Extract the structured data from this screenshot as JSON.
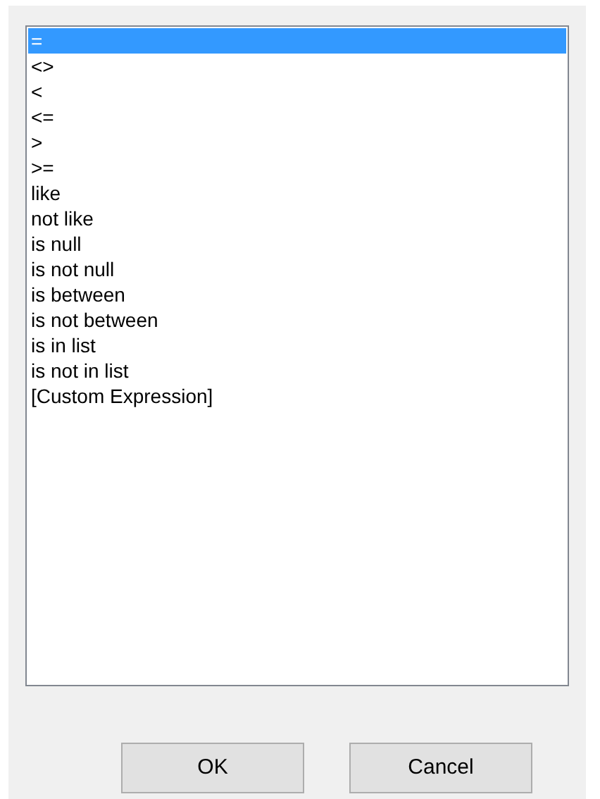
{
  "operators": [
    {
      "label": "=",
      "selected": true
    },
    {
      "label": "<>",
      "selected": false
    },
    {
      "label": "<",
      "selected": false
    },
    {
      "label": "<=",
      "selected": false
    },
    {
      "label": ">",
      "selected": false
    },
    {
      "label": ">=",
      "selected": false
    },
    {
      "label": "like",
      "selected": false
    },
    {
      "label": "not like",
      "selected": false
    },
    {
      "label": "is null",
      "selected": false
    },
    {
      "label": "is not null",
      "selected": false
    },
    {
      "label": "is between",
      "selected": false
    },
    {
      "label": "is not between",
      "selected": false
    },
    {
      "label": "is in list",
      "selected": false
    },
    {
      "label": "is not in list",
      "selected": false
    },
    {
      "label": "[Custom Expression]",
      "selected": false
    }
  ],
  "buttons": [
    "OK",
    "Cancel"
  ]
}
